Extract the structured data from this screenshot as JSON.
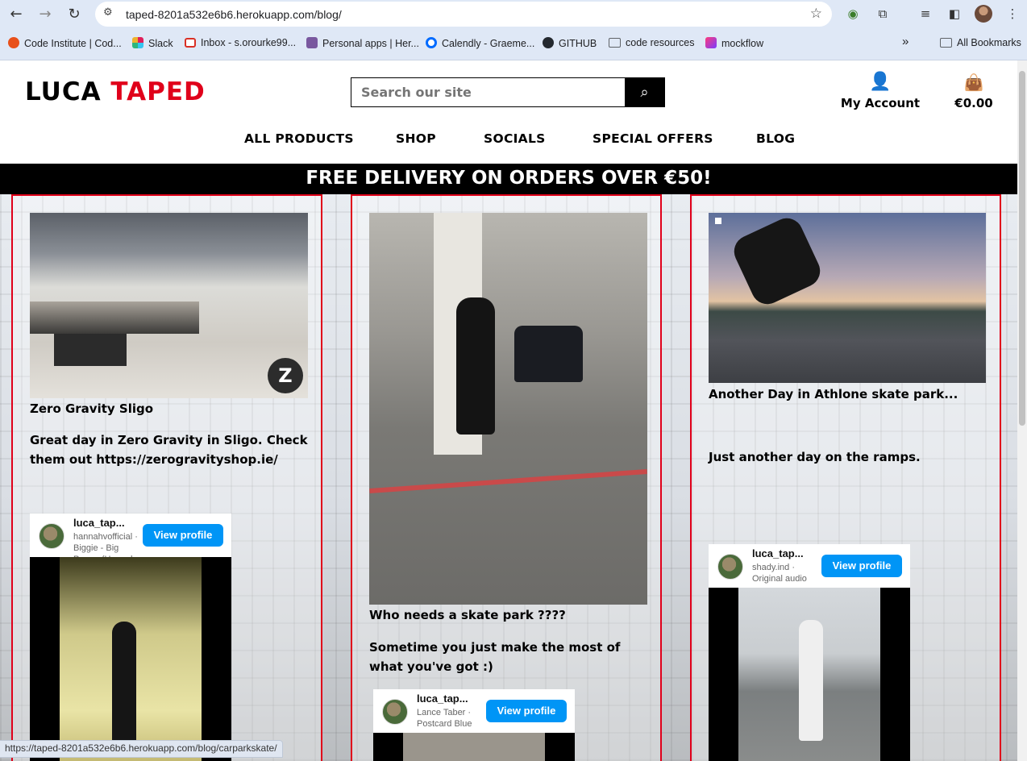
{
  "browser": {
    "back_icon": "←",
    "forward_icon": "→",
    "reload_icon": "↻",
    "url": "taped-8201a532e6b6.herokuapp.com/blog/",
    "bookmarks": [
      {
        "label": "Code Institute | Cod...",
        "color": "#e8501a"
      },
      {
        "label": "Slack",
        "color": "#4a154b"
      },
      {
        "label": "Inbox - s.orourke99...",
        "color": "#d93025"
      },
      {
        "label": "Personal apps | Her...",
        "color": "#79589f"
      },
      {
        "label": "Calendly - Graeme...",
        "color": "#006bff"
      },
      {
        "label": "GITHUB",
        "color": "#24292f"
      },
      {
        "label": "code resources",
        "color": "#5f6368"
      },
      {
        "label": "mockflow",
        "color": "#8a2be2"
      }
    ],
    "bookmarks_overflow": "»",
    "all_bookmarks": "All Bookmarks",
    "status_url": "https://taped-8201a532e6b6.herokuapp.com/blog/carparkskate/"
  },
  "site": {
    "logo_part1": "LUCA",
    "logo_part2": "TAPED",
    "search_placeholder": "Search our site",
    "account_label": "My Account",
    "bag_total": "€0.00",
    "nav": [
      "ALL PRODUCTS",
      "SHOP",
      "SOCIALS",
      "SPECIAL OFFERS",
      "BLOG"
    ],
    "banner": "FREE DELIVERY ON ORDERS OVER €50!",
    "accent_color": "#e0001a"
  },
  "posts": [
    {
      "title": "Zero Gravity Sligo",
      "body": "Great day in Zero Gravity in Sligo. Check them out https://zerogravityshop.ie/",
      "embed": {
        "name": "luca_tap...",
        "sub": "hannahvofficial · Biggie - Big Poppa (Hannah",
        "button": "View profile"
      }
    },
    {
      "title": "Who needs a skate park ????",
      "body": "Sometime you just make the most of what you've got :)",
      "embed": {
        "name": "luca_tap...",
        "sub": "Lance Taber · Postcard Blue",
        "button": "View profile"
      }
    },
    {
      "title": "Another Day in Athlone skate park...",
      "body": "Just another day on the ramps.",
      "embed": {
        "name": "luca_tap...",
        "sub": "shady.ind · Original audio",
        "button": "View profile"
      }
    }
  ]
}
